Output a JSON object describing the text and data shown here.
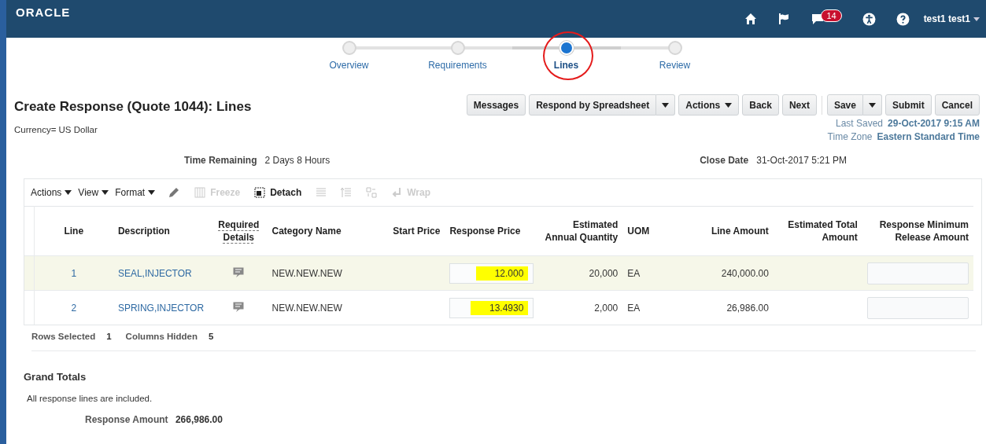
{
  "header": {
    "logo": "ORACLE",
    "notification_count": "14",
    "user": "test1 test1"
  },
  "train": [
    {
      "label": "Overview",
      "selected": false,
      "circled": false
    },
    {
      "label": "Requirements",
      "selected": false,
      "circled": false
    },
    {
      "label": "Lines",
      "selected": true,
      "circled": true
    },
    {
      "label": "Review",
      "selected": false,
      "circled": false
    }
  ],
  "page_title": "Create Response (Quote 1044): Lines",
  "currency": "Currency= US Dollar",
  "buttons": [
    {
      "label": "Messages",
      "kind": "button"
    },
    {
      "label": "Respond by Spreadsheet",
      "kind": "split"
    },
    {
      "label": "Actions",
      "kind": "menu"
    },
    {
      "label": "Back",
      "kind": "button"
    },
    {
      "label": "Next",
      "kind": "button"
    },
    {
      "label": "Save",
      "kind": "split"
    },
    {
      "label": "Submit",
      "kind": "button"
    },
    {
      "label": "Cancel",
      "kind": "button"
    }
  ],
  "last_saved": {
    "label": "Last Saved",
    "value": "29-Oct-2017 9:15 AM"
  },
  "time_zone": {
    "label": "Time Zone",
    "value": "Eastern Standard Time"
  },
  "time_remaining": {
    "label": "Time Remaining",
    "value": "2 Days 8 Hours"
  },
  "close_date": {
    "label": "Close Date",
    "value": "31-Oct-2017 5:21 PM"
  },
  "toolbar": [
    {
      "label": "Actions",
      "kind": "menu",
      "disabled": false
    },
    {
      "label": "View",
      "kind": "menu",
      "disabled": false
    },
    {
      "label": "Format",
      "kind": "menu",
      "disabled": false
    },
    {
      "kind": "edit",
      "disabled": false
    },
    {
      "label": "Freeze",
      "kind": "freeze",
      "disabled": true
    },
    {
      "label": "Detach",
      "kind": "detach",
      "disabled": false
    },
    {
      "kind": "rows",
      "disabled": true
    },
    {
      "kind": "rows-up",
      "disabled": true
    },
    {
      "kind": "columns",
      "disabled": true
    },
    {
      "label": "Wrap",
      "kind": "wrap",
      "disabled": true
    }
  ],
  "table": {
    "columns": [
      "Line",
      "Description",
      "Required Details",
      "Category Name",
      "Start Price",
      "Response Price",
      "Estimated Annual Quantity",
      "UOM",
      "Line Amount",
      "Estimated Total Amount",
      "Response Minimum Release Amount"
    ],
    "rows": [
      {
        "line": "1",
        "description": "SEAL,INJECTOR",
        "category": "NEW.NEW.NEW",
        "response_price": "12.000",
        "highlighted": true,
        "quantity": "20,000",
        "uom": "EA",
        "line_amount": "240,000.00",
        "selected": true
      },
      {
        "line": "2",
        "description": "SPRING,INJECTOR",
        "category": "NEW.NEW.NEW",
        "response_price": "13.4930",
        "highlighted": true,
        "quantity": "2,000",
        "uom": "EA",
        "line_amount": "26,986.00",
        "selected": false
      }
    ]
  },
  "status": {
    "rows_selected_label": "Rows Selected",
    "rows_selected": "1",
    "columns_hidden_label": "Columns Hidden",
    "columns_hidden": "5"
  },
  "grand_totals": {
    "title": "Grand Totals",
    "note": "All response lines are included.",
    "label": "Response Amount",
    "value": "266,986.00"
  }
}
